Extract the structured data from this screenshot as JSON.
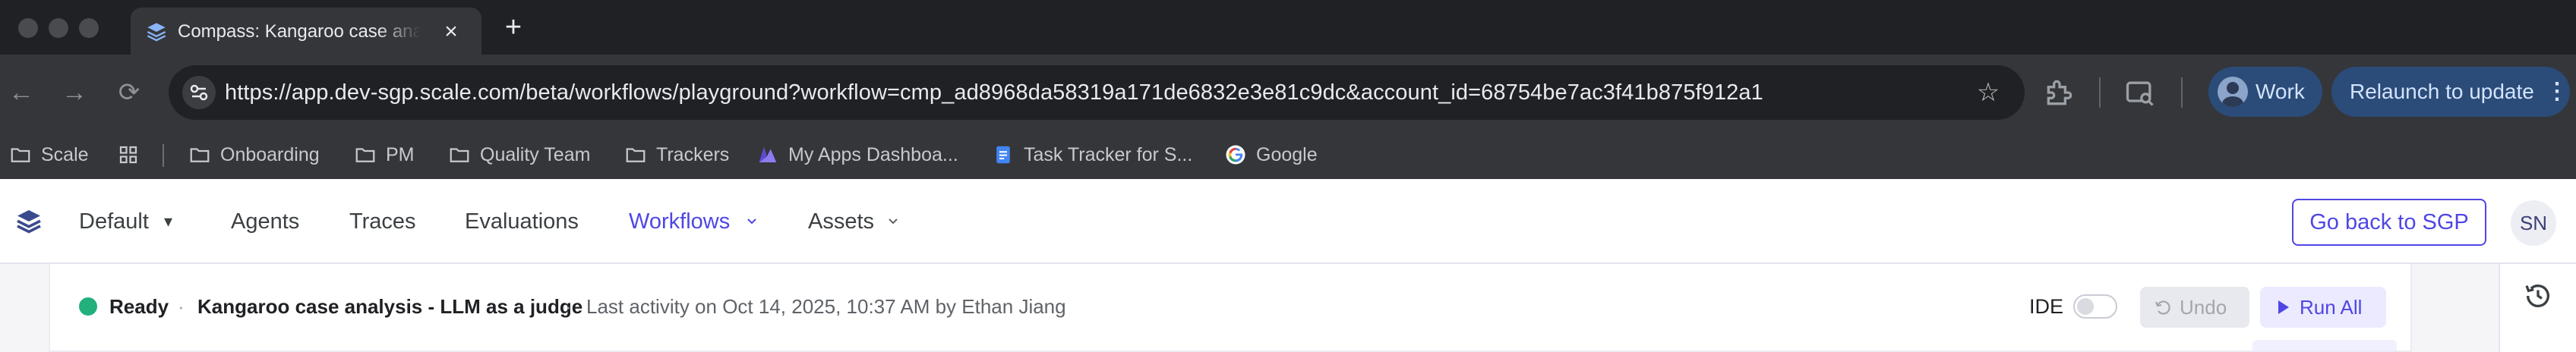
{
  "browser": {
    "tab": {
      "title": "Compass: Kangaroo case analysis - LLM as a judge",
      "close_icon": "×",
      "new_tab_icon": "+"
    },
    "nav_icons": {
      "back": "←",
      "forward": "→",
      "reload": "⟳"
    },
    "url": "https://app.dev-sgp.scale.com/beta/workflows/playground?workflow=cmp_ad8968da58319a171de6832e3e81c9dc&account_id=68754be7ac3f41b875f912a1",
    "star_icon": "☆",
    "profile": {
      "label": "Work"
    },
    "relaunch": {
      "label": "Relaunch to update",
      "menu_icon": "⋮"
    },
    "bookmarks": [
      {
        "label": "Scale",
        "icon": "folder-icon"
      },
      {
        "label": "",
        "icon": "apps-grid-icon"
      },
      {
        "label": "Onboarding",
        "icon": "folder-icon"
      },
      {
        "label": "PM",
        "icon": "folder-icon"
      },
      {
        "label": "Quality Team",
        "icon": "folder-icon"
      },
      {
        "label": "Trackers",
        "icon": "folder-icon"
      },
      {
        "label": "My Apps Dashboa...",
        "icon": "app-icon"
      },
      {
        "label": "Task Tracker for S...",
        "icon": "docs-icon"
      },
      {
        "label": "Google",
        "icon": "google-icon"
      }
    ]
  },
  "app": {
    "nav": {
      "default_label": "Default",
      "items": [
        "Agents",
        "Traces",
        "Evaluations",
        "Workflows",
        "Assets"
      ],
      "active": "Workflows",
      "go_back_label": "Go back to SGP",
      "avatar_initials": "SN"
    },
    "status": {
      "state": "Ready",
      "workflow_name": "Kangaroo case analysis - LLM as a judge",
      "last_activity": "Last activity on Oct 14, 2025, 10:37 AM by Ethan Jiang",
      "separator": "·",
      "ide_label": "IDE",
      "ide_enabled": false,
      "undo_label": "Undo",
      "run_all_label": "Run All"
    },
    "colors": {
      "accent": "#4f46e5",
      "ready": "#22b07d"
    }
  }
}
